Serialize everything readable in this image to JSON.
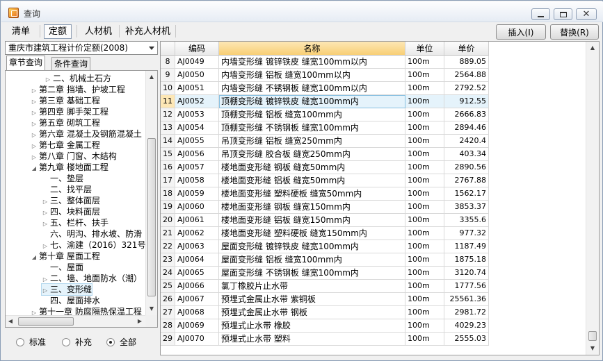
{
  "window": {
    "title": "查询"
  },
  "top_tabs": [
    {
      "label": "清单",
      "selected": false
    },
    {
      "label": "定额",
      "selected": true
    },
    {
      "label": "人材机",
      "selected": false
    },
    {
      "label": "补充人材机",
      "selected": false
    }
  ],
  "actions": {
    "insert": "插入(I)",
    "replace": "替换(R)"
  },
  "left": {
    "library": "重庆市建筑工程计价定额(2008)",
    "tabs": [
      "章节查询",
      "条件查询"
    ],
    "tree": [
      {
        "label": "二、机械土石方",
        "level": 2,
        "expander": "collapsed"
      },
      {
        "label": "第二章  挡墙、护坡工程",
        "level": 0,
        "expander": "collapsed"
      },
      {
        "label": "第三章  基础工程",
        "level": 0,
        "expander": "collapsed"
      },
      {
        "label": "第四章  脚手架工程",
        "level": 0,
        "expander": "collapsed"
      },
      {
        "label": "第五章  砌筑工程",
        "level": 0,
        "expander": "collapsed"
      },
      {
        "label": "第六章  混凝土及钢筋混凝土",
        "level": 0,
        "expander": "collapsed"
      },
      {
        "label": "第七章  金属工程",
        "level": 0,
        "expander": "collapsed"
      },
      {
        "label": "第八章  门窗、木结构",
        "level": 0,
        "expander": "collapsed"
      },
      {
        "label": "第九章  楼地面工程",
        "level": 0,
        "expander": "expanded"
      },
      {
        "label": "一、垫层",
        "level": 1,
        "expander": "none"
      },
      {
        "label": "二、找平层",
        "level": 1,
        "expander": "none"
      },
      {
        "label": "三、整体面层",
        "level": 1,
        "expander": "collapsed"
      },
      {
        "label": "四、块料面层",
        "level": 1,
        "expander": "collapsed"
      },
      {
        "label": "五、栏杆、扶手",
        "level": 1,
        "expander": "collapsed"
      },
      {
        "label": "六、明沟、排水坡、防滑",
        "level": 1,
        "expander": "none"
      },
      {
        "label": "七、渝建（2016）321号",
        "level": 1,
        "expander": "collapsed"
      },
      {
        "label": "第十章  屋面工程",
        "level": 0,
        "expander": "expanded"
      },
      {
        "label": "一、屋面",
        "level": 1,
        "expander": "none"
      },
      {
        "label": "二、墙、地面防水（潮）",
        "level": 1,
        "expander": "collapsed"
      },
      {
        "label": "三、变形缝",
        "level": 1,
        "expander": "collapsed",
        "selected": true
      },
      {
        "label": "四、屋面排水",
        "level": 1,
        "expander": "none"
      },
      {
        "label": "第十一章  防腐隔热保温工程",
        "level": 0,
        "expander": "collapsed"
      }
    ],
    "filters": [
      {
        "label": "标准",
        "checked": false
      },
      {
        "label": "补充",
        "checked": false
      },
      {
        "label": "全部",
        "checked": true
      }
    ]
  },
  "table": {
    "columns": [
      "",
      "编码",
      "名称",
      "单位",
      "单价"
    ],
    "sorted_column": "名称",
    "selected_row": "11",
    "rows": [
      [
        "8",
        "AJ0049",
        "内墙变形缝  镀锌铁皮  缝宽100mm以内",
        "100m",
        "889.05"
      ],
      [
        "9",
        "AJ0050",
        "内墙变形缝  铝板  缝宽100mm以内",
        "100m",
        "2564.88"
      ],
      [
        "10",
        "AJ0051",
        "内墙变形缝  不锈钢板  缝宽100mm以内",
        "100m",
        "2792.52"
      ],
      [
        "11",
        "AJ0052",
        "顶棚变形缝  镀锌铁皮  缝宽100mm内",
        "100m",
        "912.55"
      ],
      [
        "12",
        "AJ0053",
        "顶棚变形缝  铝板  缝宽100mm内",
        "100m",
        "2666.83"
      ],
      [
        "13",
        "AJ0054",
        "顶棚变形缝  不锈钢板  缝宽100mm内",
        "100m",
        "2894.46"
      ],
      [
        "14",
        "AJ0055",
        "吊顶变形缝  铝板  缝宽250mm内",
        "100m",
        "2420.4"
      ],
      [
        "15",
        "AJ0056",
        "吊顶变形缝  胶合板  缝宽250mm内",
        "100m",
        "403.34"
      ],
      [
        "16",
        "AJ0057",
        "楼地面变形缝  钢板  缝宽50mm内",
        "100m",
        "2890.56"
      ],
      [
        "17",
        "AJ0058",
        "楼地面变形缝  铝板  缝宽50mm内",
        "100m",
        "2767.88"
      ],
      [
        "18",
        "AJ0059",
        "楼地面变形缝  塑料硬板  缝宽50mm内",
        "100m",
        "1562.17"
      ],
      [
        "19",
        "AJ0060",
        "楼地面变形缝  钢板  缝宽150mm内",
        "100m",
        "3853.37"
      ],
      [
        "20",
        "AJ0061",
        "楼地面变形缝  铝板  缝宽150mm内",
        "100m",
        "3355.6"
      ],
      [
        "21",
        "AJ0062",
        "楼地面变形缝  塑料硬板  缝宽150mm内",
        "100m",
        "977.32"
      ],
      [
        "22",
        "AJ0063",
        "屋面变形缝  镀锌铁皮  缝宽100mm内",
        "100m",
        "1187.49"
      ],
      [
        "23",
        "AJ0064",
        "屋面变形缝  铝板  缝宽100mm内",
        "100m",
        "1875.18"
      ],
      [
        "24",
        "AJ0065",
        "屋面变形缝  不锈钢板  缝宽100mm内",
        "100m",
        "3120.74"
      ],
      [
        "25",
        "AJ0066",
        "氯丁橡胶片止水带",
        "100m",
        "1777.56"
      ],
      [
        "26",
        "AJ0067",
        "预埋式金属止水带  紫铜板",
        "100m",
        "25561.36"
      ],
      [
        "27",
        "AJ0068",
        "预埋式金属止水带  钢板",
        "100m",
        "2981.72"
      ],
      [
        "28",
        "AJ0069",
        "预埋式止水带  橡胶",
        "100m",
        "4029.23"
      ],
      [
        "29",
        "AJ0070",
        "预埋式止水带  塑料",
        "100m",
        "2555.03"
      ]
    ]
  },
  "colors": {
    "selected_row": "#e5f3fb",
    "selected_border": "#86bfe0",
    "sorted_header": "#f8cf75"
  }
}
